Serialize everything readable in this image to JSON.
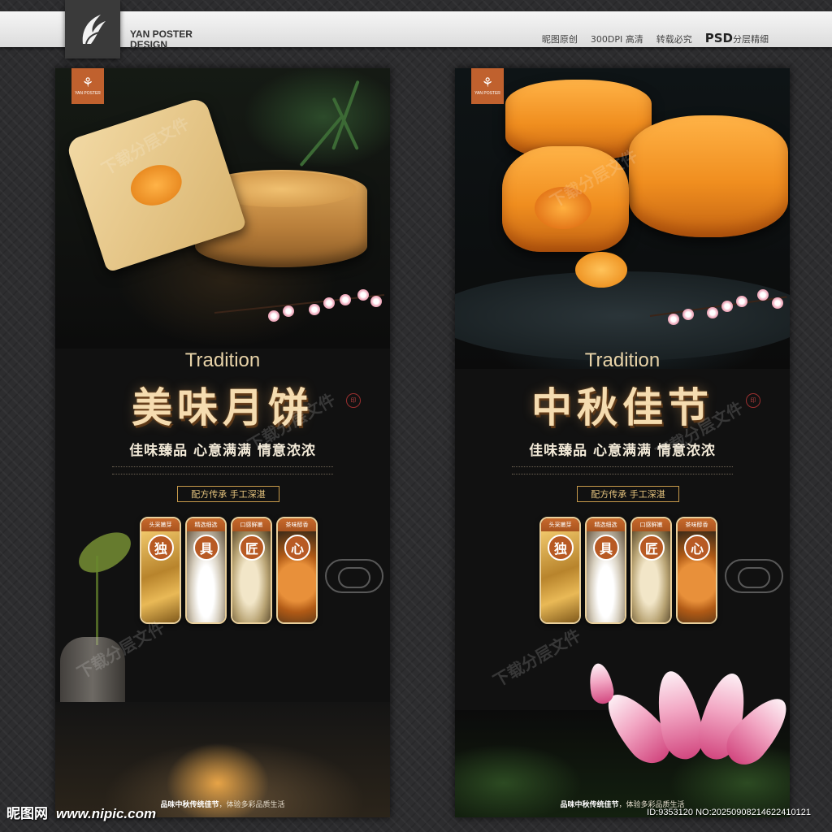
{
  "header": {
    "brand_line1": "YAN POSTER",
    "brand_line2": "DESIGN",
    "links": [
      "昵图原创",
      "300DPI 高清",
      "转载必究"
    ],
    "psd_label": "PSD",
    "psd_suffix": "分层精细"
  },
  "logo_tag": {
    "mark": "⚘",
    "text": "YAN POSTER"
  },
  "poster_left": {
    "tradition": "Tradition",
    "title": "美味月饼",
    "subtitle": "佳味臻品 心意满满 情意浓浓",
    "tag": "配方传承 手工深湛",
    "cards": [
      {
        "head": "头采嫩芽",
        "char": "独"
      },
      {
        "head": "精选细选",
        "char": "具"
      },
      {
        "head": "口感鲜嫩",
        "char": "匠"
      },
      {
        "head": "茶味醇香",
        "char": "心"
      }
    ],
    "footer_bold": "品味中秋传统佳节",
    "footer_rest": "，体验多彩品质生活"
  },
  "poster_right": {
    "tradition": "Tradition",
    "title": "中秋佳节",
    "subtitle": "佳味臻品 心意满满 情意浓浓",
    "tag": "配方传承 手工深湛",
    "cards": [
      {
        "head": "头采嫩芽",
        "char": "独"
      },
      {
        "head": "精选细选",
        "char": "具"
      },
      {
        "head": "口感鲜嫩",
        "char": "匠"
      },
      {
        "head": "茶味醇香",
        "char": "心"
      }
    ],
    "footer_bold": "品味中秋传统佳节",
    "footer_rest": "，体验多彩品质生活"
  },
  "watermark": "下载分层文件",
  "bottom": {
    "site_cn": "昵图网",
    "site_url": "www.nipic.com",
    "id_line": "ID:9353120 NO:20250908214622410121"
  },
  "colors": {
    "accent": "#c0612e",
    "gold": "#e4c27d",
    "title": "#f5dcb0"
  }
}
